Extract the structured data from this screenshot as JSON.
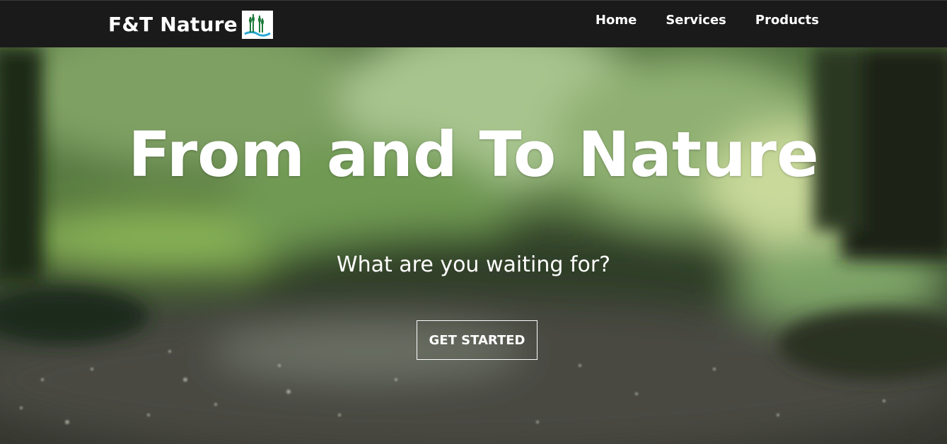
{
  "navbar": {
    "brand_text": "F&T Nature",
    "brand_logo_icon": "reeds-water-logo-icon",
    "links": [
      {
        "label": "Home"
      },
      {
        "label": "Services"
      },
      {
        "label": "Products"
      }
    ]
  },
  "hero": {
    "title": "From and To Nature",
    "subtitle": "What are you waiting for?",
    "cta_label": "GET STARTED",
    "background": "blurred-forest-rain-photo"
  },
  "colors": {
    "navbar_bg": "#1b1a1b",
    "text": "#ffffff",
    "logo_green": "#1e7a3a",
    "logo_blue": "#2aa7d6"
  }
}
